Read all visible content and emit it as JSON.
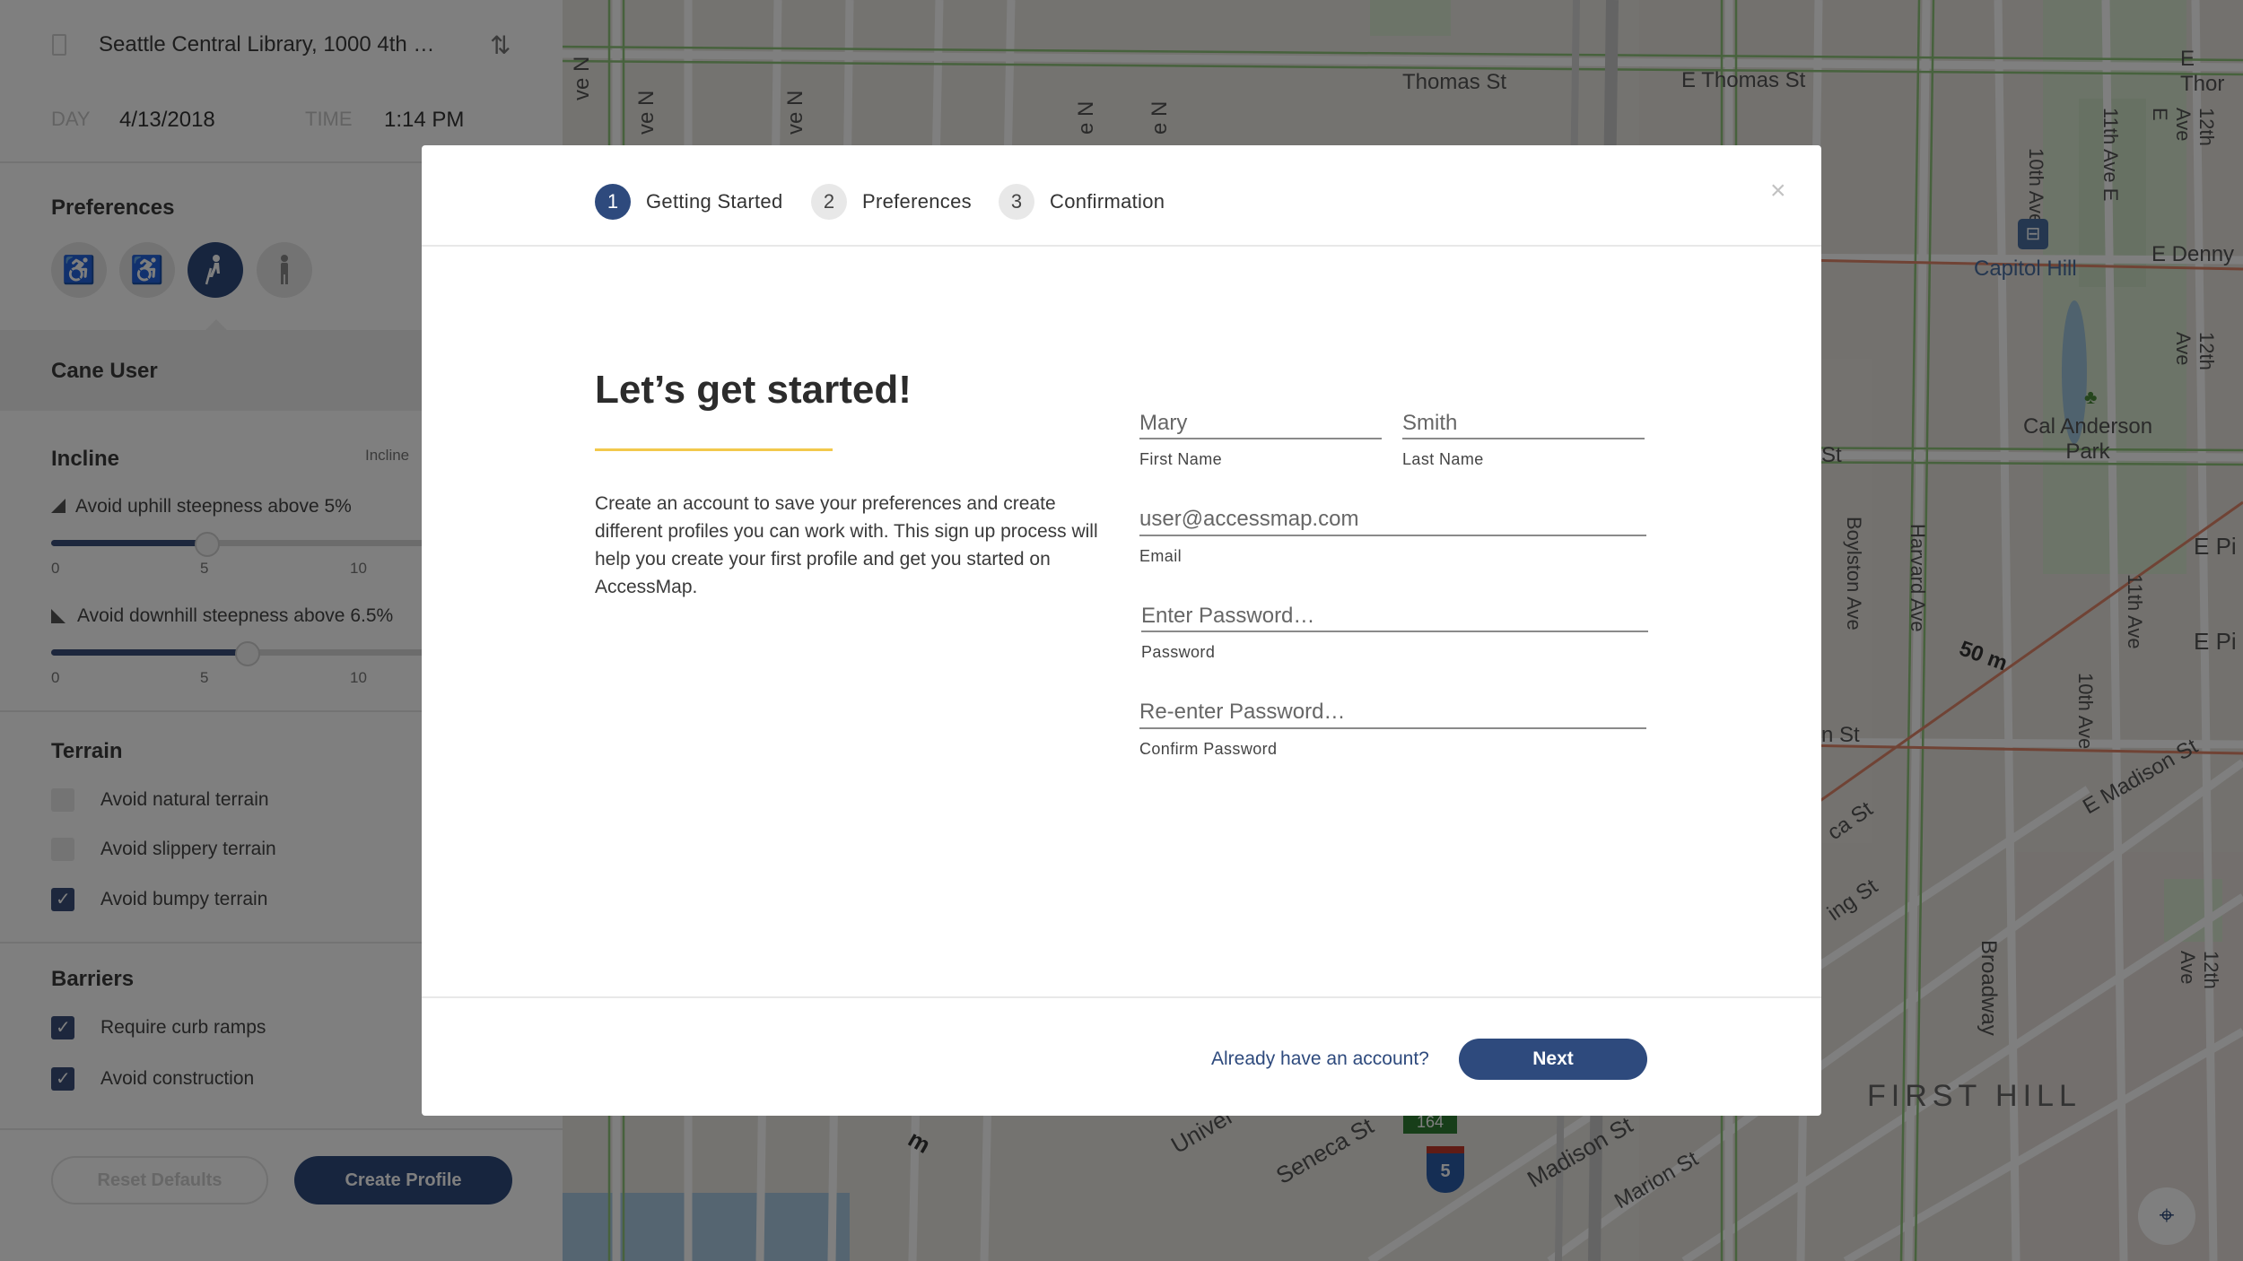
{
  "route": {
    "origin_text": "Seattle Central Library, 1000 4th …",
    "day_label": "DAY",
    "day_value": "4/13/2018",
    "time_label": "TIME",
    "time_value": "1:14 PM"
  },
  "preferences": {
    "title": "Preferences",
    "modes": [
      {
        "icon": "wheelchair-icon",
        "active": false
      },
      {
        "icon": "power-wheelchair-icon",
        "active": false
      },
      {
        "icon": "cane-user-icon",
        "active": true
      },
      {
        "icon": "walking-person-icon",
        "active": false
      }
    ],
    "profile_name": "Cane User"
  },
  "incline": {
    "title": "Incline",
    "side_label": "Incline",
    "uphill_label": "Avoid uphill steepness above 5%",
    "uphill_value": 5,
    "downhill_label": "Avoid downhill steepness above 6.5%",
    "downhill_value": 6.5,
    "ticks": [
      "0",
      "5",
      "10"
    ]
  },
  "terrain": {
    "title": "Terrain",
    "items": [
      {
        "label": "Avoid natural terrain",
        "checked": false
      },
      {
        "label": "Avoid slippery terrain",
        "checked": false
      },
      {
        "label": "Avoid bumpy terrain",
        "checked": true
      }
    ]
  },
  "barriers": {
    "title": "Barriers",
    "items": [
      {
        "label": "Require curb ramps",
        "checked": true
      },
      {
        "label": "Avoid construction",
        "checked": true
      }
    ]
  },
  "sidebar_buttons": {
    "reset": "Reset Defaults",
    "create": "Create Profile"
  },
  "map_labels": {
    "streets": [
      "Thomas St",
      "E Thomas St",
      "E Thor",
      "10th Ave E",
      "11th Ave E",
      "12th Ave E",
      "E Denny",
      "Capitol Hill",
      "Cal Anderson Park",
      "St",
      "Boylston Ave",
      "Harvard Ave",
      "11th Ave",
      "50 m",
      "10th Ave",
      "E Pi",
      "E Pi",
      "n St",
      "E Madison St",
      "ca St",
      "ing St",
      "Broadway",
      "12th Ave",
      "12th Ave",
      "FIRST HILL",
      "Univer",
      "Seneca St",
      "Madison St",
      "Marion St",
      "m"
    ],
    "ave_fragments": [
      "ve N",
      "ve N",
      "ve N",
      "e N",
      "e N"
    ],
    "shields": [
      "5",
      "164"
    ]
  },
  "modal": {
    "steps": [
      {
        "num": "1",
        "label": "Getting Started",
        "active": true
      },
      {
        "num": "2",
        "label": "Preferences",
        "active": false
      },
      {
        "num": "3",
        "label": "Confirmation",
        "active": false
      }
    ],
    "close": "×",
    "heading": "Let’s get started!",
    "intro": "Create an account to save your preferences and create different profiles you can work with. This sign up process will help you create your first profile and get you started on AccessMap.",
    "fields": {
      "first_name": {
        "value": "Mary",
        "label": "First Name"
      },
      "last_name": {
        "value": "Smith",
        "label": "Last Name"
      },
      "email": {
        "placeholder": "user@accessmap.com",
        "label": "Email"
      },
      "password": {
        "placeholder": "Enter Password…",
        "label": "Password"
      },
      "confirm": {
        "placeholder": "Re-enter Password…",
        "label": "Confirm Password"
      }
    },
    "login_link": "Already have an account?",
    "next_button": "Next"
  },
  "colors": {
    "accent": "#2e4a7d",
    "underline": "#f2c94c"
  }
}
